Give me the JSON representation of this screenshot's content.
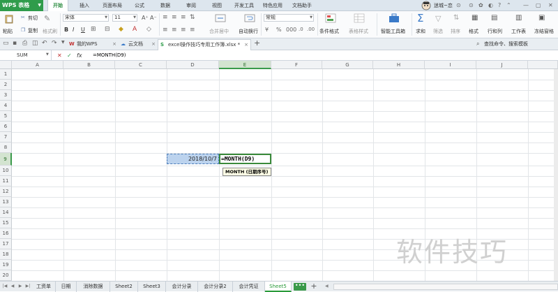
{
  "app": {
    "title": "WPS 表格"
  },
  "menu": [
    {
      "label": "开始",
      "active": true
    },
    {
      "label": "插入"
    },
    {
      "label": "页面布局"
    },
    {
      "label": "公式"
    },
    {
      "label": "数据"
    },
    {
      "label": "审阅"
    },
    {
      "label": "视图"
    },
    {
      "label": "开发工具"
    },
    {
      "label": "特色应用"
    },
    {
      "label": "文档助手"
    }
  ],
  "user": {
    "name": "迷城~恋"
  },
  "ribbon": {
    "paste": "粘贴",
    "cut": "剪切",
    "copy": "复制",
    "format_painter": "格式刷",
    "font_name": "宋体",
    "font_size": "11",
    "bold": "B",
    "italic": "I",
    "underline": "U",
    "merge_center": "合并居中",
    "wrap_text": "自动换行",
    "number_format": "常规",
    "conditional_format": "条件格式",
    "table_style": "表格样式",
    "smart_toolbox": "智能工具箱",
    "sum": "求和",
    "filter": "筛选",
    "sort": "排序",
    "format": "格式",
    "row_col": "行和列",
    "worksheet": "工作表",
    "freeze": "冻结窗格",
    "search_placeholder": "查找命令、搜索模板"
  },
  "doc_tabs": [
    {
      "label": "我的WPS"
    },
    {
      "label": "云文档"
    },
    {
      "label": "excel操作技巧专用工作簿.xlsx *",
      "active": true
    }
  ],
  "formula_bar": {
    "name_box": "SUM",
    "cancel": "✕",
    "confirm": "✓",
    "fx": "fx",
    "formula": "=MONTH(D9)"
  },
  "columns": [
    "A",
    "B",
    "C",
    "D",
    "E",
    "F",
    "G",
    "H",
    "I",
    "J"
  ],
  "rows": [
    "1",
    "2",
    "3",
    "4",
    "5",
    "6",
    "7",
    "8",
    "9",
    "10",
    "11",
    "12",
    "13",
    "14",
    "15",
    "16",
    "17",
    "18",
    "19",
    "20"
  ],
  "cells": {
    "D9": "2018/10/7",
    "E9": "=MONTH(D9)"
  },
  "tooltip": "MONTH (日期序号)",
  "sheets": [
    {
      "label": "工资单"
    },
    {
      "label": "日期"
    },
    {
      "label": "消除数据"
    },
    {
      "label": "Sheet2"
    },
    {
      "label": "Sheet3"
    },
    {
      "label": "会计分录"
    },
    {
      "label": "会计分录2"
    },
    {
      "label": "会计凭证"
    },
    {
      "label": "Sheet5",
      "active": true
    }
  ],
  "sheet_more": "•••",
  "sheet_add": "+",
  "watermark": "软件技巧",
  "colors": {
    "accent": "#2f9c4b",
    "selection": "#bcd3ee"
  }
}
